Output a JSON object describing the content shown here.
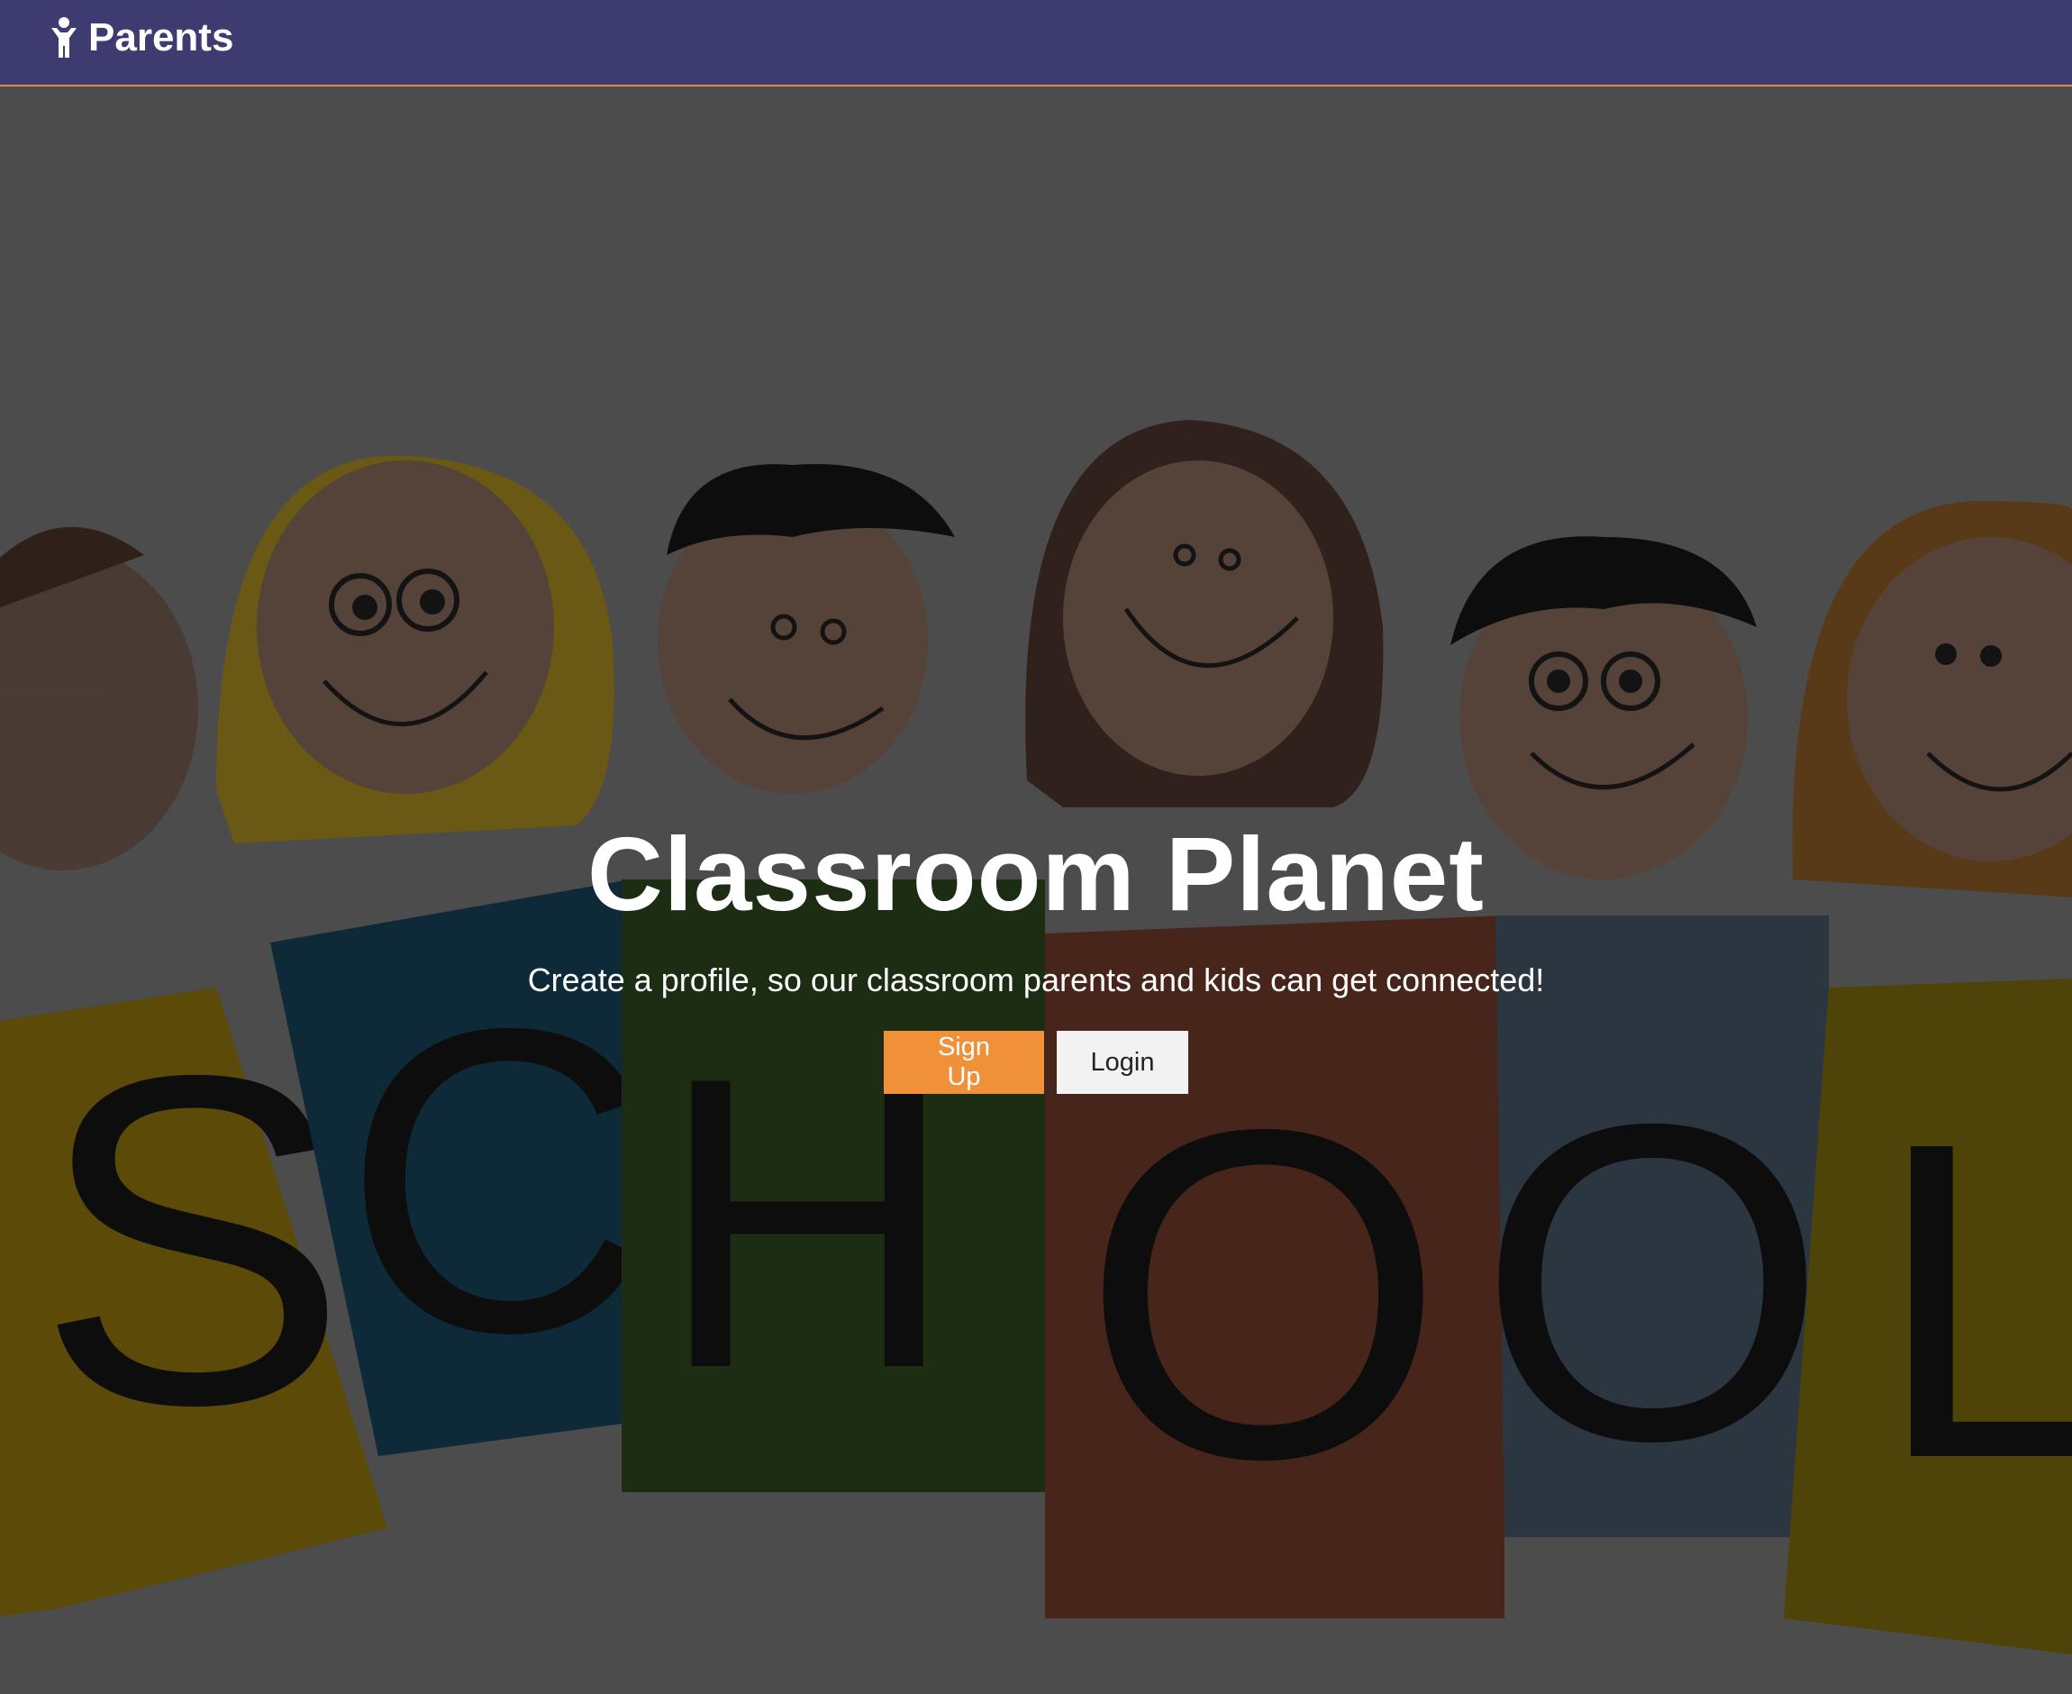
{
  "nav": {
    "brand_label": "Parents",
    "brand_icon": "child-icon",
    "background": "#3d3b70",
    "border_color": "#e08a4a"
  },
  "hero": {
    "background_image": "cartoon kids holding letters spelling SCHOOL",
    "title": "Classroom Planet",
    "subtitle": "Create a profile, so our classroom parents and kids can get connected!",
    "signup_label": "Sign Up",
    "login_label": "Login",
    "accent_color": "#f0913a"
  }
}
